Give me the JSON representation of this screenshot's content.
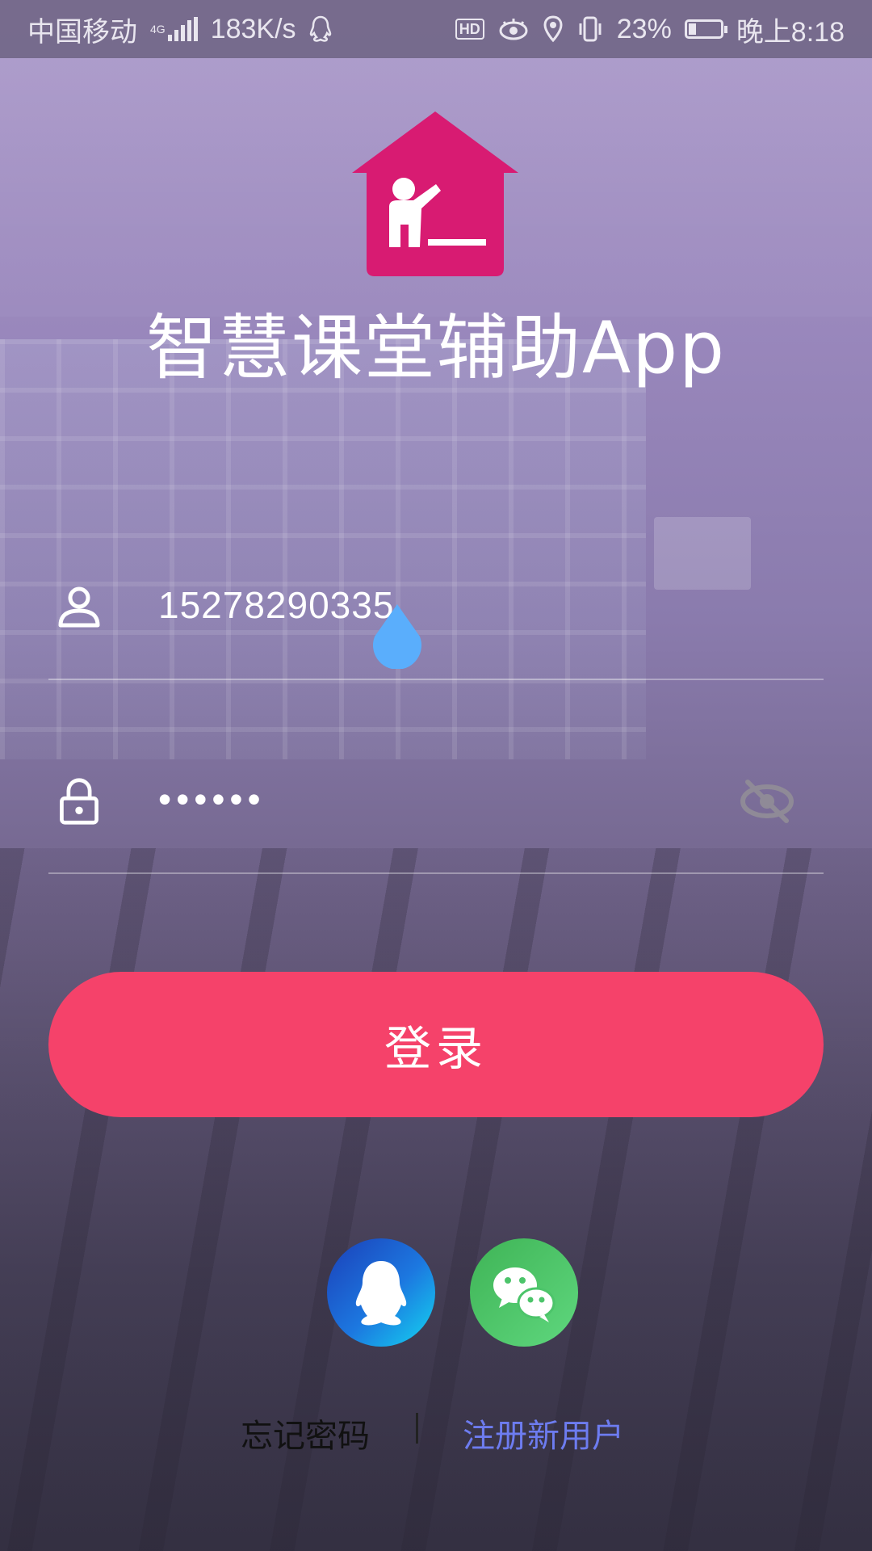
{
  "status_bar": {
    "carrier": "中国移动",
    "network": "4G",
    "speed": "183K/s",
    "battery_percent": "23%",
    "battery_level": 0.23,
    "time": "晚上8:18",
    "hd_label": "HD"
  },
  "app": {
    "title": "智慧课堂辅助App",
    "logo_color": "#d81b72"
  },
  "login_form": {
    "username_value": "15278290335",
    "password_mask": "••••••",
    "login_button_label": "登录",
    "accent_color": "#f5426a",
    "handle_color": "#5aaefc"
  },
  "social_login": {
    "qq_icon": "qq-penguin-icon",
    "wechat_icon": "wechat-icon"
  },
  "bottom_links": {
    "forgot_password": "忘记密码",
    "divider": "|",
    "register": "注册新用户",
    "register_color": "#6d7cf0"
  }
}
